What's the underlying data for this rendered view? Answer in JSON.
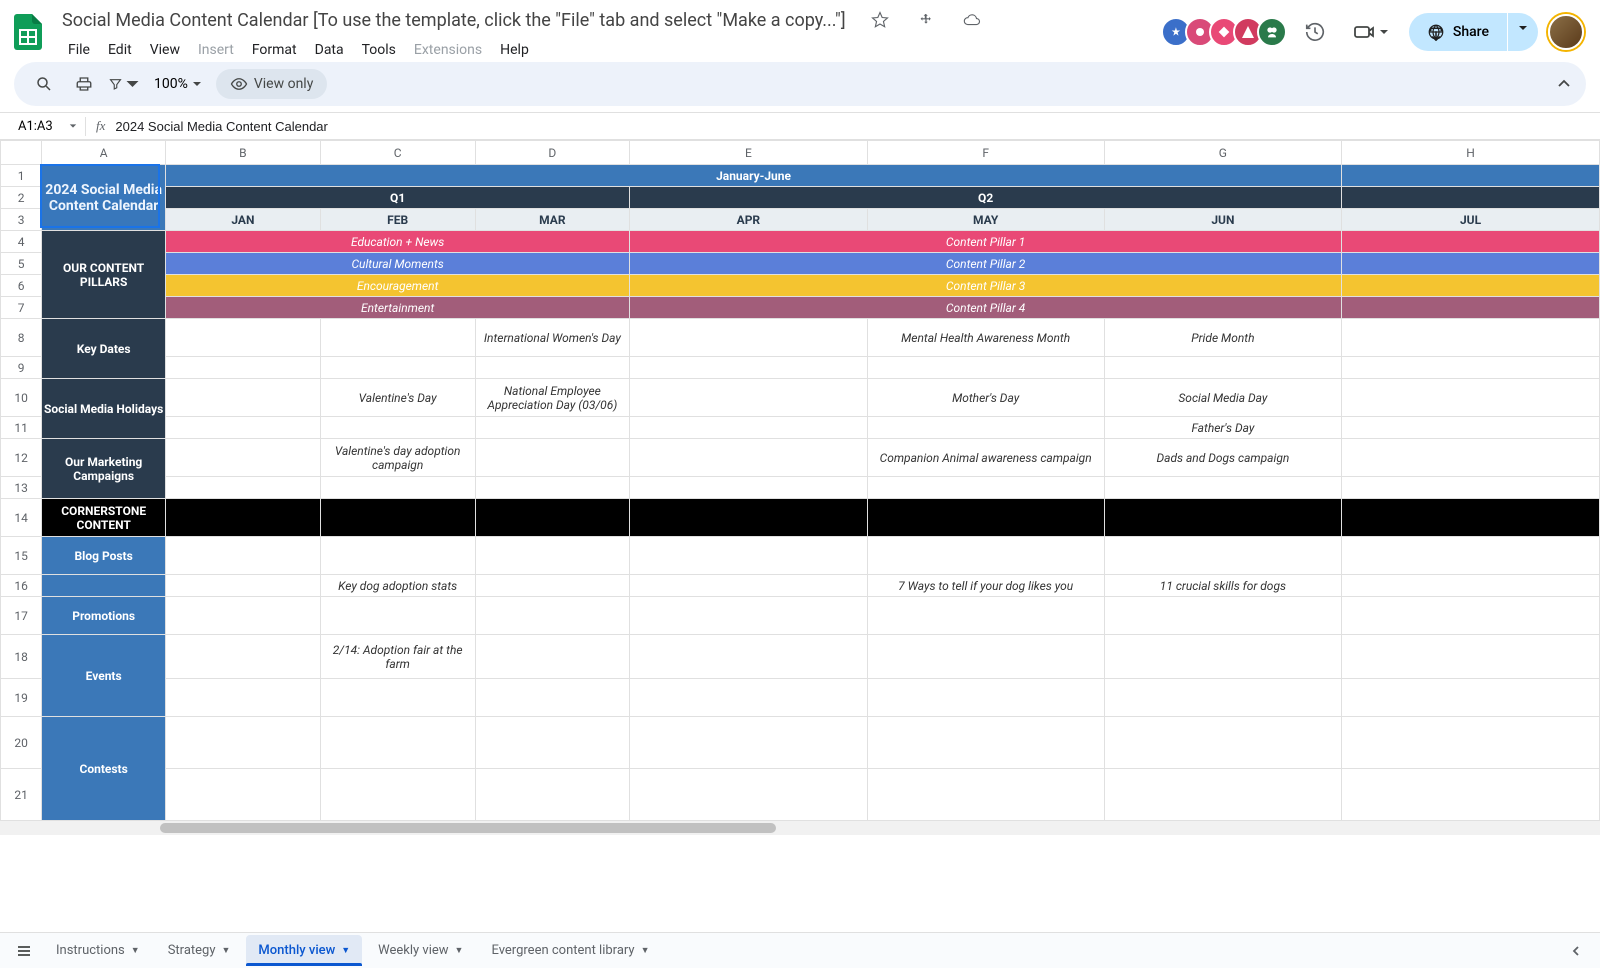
{
  "doc": {
    "title": "Social Media Content Calendar [To use the template, click the \"File\" tab and select \"Make a copy...\"]"
  },
  "menus": {
    "file": "File",
    "edit": "Edit",
    "view": "View",
    "insert": "Insert",
    "format": "Format",
    "data": "Data",
    "tools": "Tools",
    "extensions": "Extensions",
    "help": "Help"
  },
  "toolbar": {
    "zoom": "100%",
    "viewonly": "View only"
  },
  "share": {
    "label": "Share"
  },
  "namebox": {
    "ref": "A1:A3"
  },
  "formula": {
    "value": "2024 Social Media Content Calendar"
  },
  "columns": [
    "A",
    "B",
    "C",
    "D",
    "E",
    "F",
    "G",
    "H"
  ],
  "rows": [
    "1",
    "2",
    "3",
    "4",
    "5",
    "6",
    "7",
    "8",
    "9",
    "10",
    "11",
    "12",
    "13",
    "14",
    "15",
    "16",
    "17",
    "18",
    "19",
    "20",
    "21"
  ],
  "labels": {
    "title": "2024 Social Media Content Calendar",
    "pillars": "OUR CONTENT PILLARS",
    "keydates": "Key Dates",
    "holidays": "Social Media Holidays",
    "campaigns": "Our Marketing Campaigns",
    "cornerstone": "CORNERSTONE CONTENT",
    "blog": "Blog Posts",
    "promotions": "Promotions",
    "events": "Events",
    "contests": "Contests"
  },
  "headers": {
    "period": "January-June",
    "q1": "Q1",
    "q2": "Q2",
    "jan": "JAN",
    "feb": "FEB",
    "mar": "MAR",
    "apr": "APR",
    "may": "MAY",
    "jun": "JUN",
    "jul": "JUL"
  },
  "pillars": {
    "edu": "Education + News",
    "p1": "Content Pillar 1",
    "culture": "Cultural Moments",
    "p2": "Content Pillar 2",
    "encourage": "Encouragement",
    "p3": "Content Pillar 3",
    "entertain": "Entertainment",
    "p4": "Content Pillar 4"
  },
  "cells": {
    "r8d": "International Women's Day",
    "r8f": "Mental Health Awareness Month",
    "r8g": "Pride Month",
    "r10c": "Valentine's Day",
    "r10d": "National Employee Appreciation Day (03/06)",
    "r10f": "Mother's Day",
    "r10g": "Social Media Day",
    "r11g": "Father's Day",
    "r12c": "Valentine's day adoption campaign",
    "r12f": "Companion Animal awareness campaign",
    "r12g": "Dads and Dogs campaign",
    "r16c": "Key dog adoption stats",
    "r16f": "7 Ways to tell if your dog likes you",
    "r16g": "11 crucial skills for dogs",
    "r18c": "2/14: Adoption fair at the farm"
  },
  "sheets": {
    "instructions": "Instructions",
    "strategy": "Strategy",
    "monthly": "Monthly view",
    "weekly": "Weekly view",
    "evergreen": "Evergreen content library"
  },
  "avatars": [
    {
      "color": "#3b6fc9"
    },
    {
      "color": "#d94a78"
    },
    {
      "color": "#e94976"
    },
    {
      "color": "#d13b5f"
    },
    {
      "color": "#2a7a4a"
    }
  ]
}
